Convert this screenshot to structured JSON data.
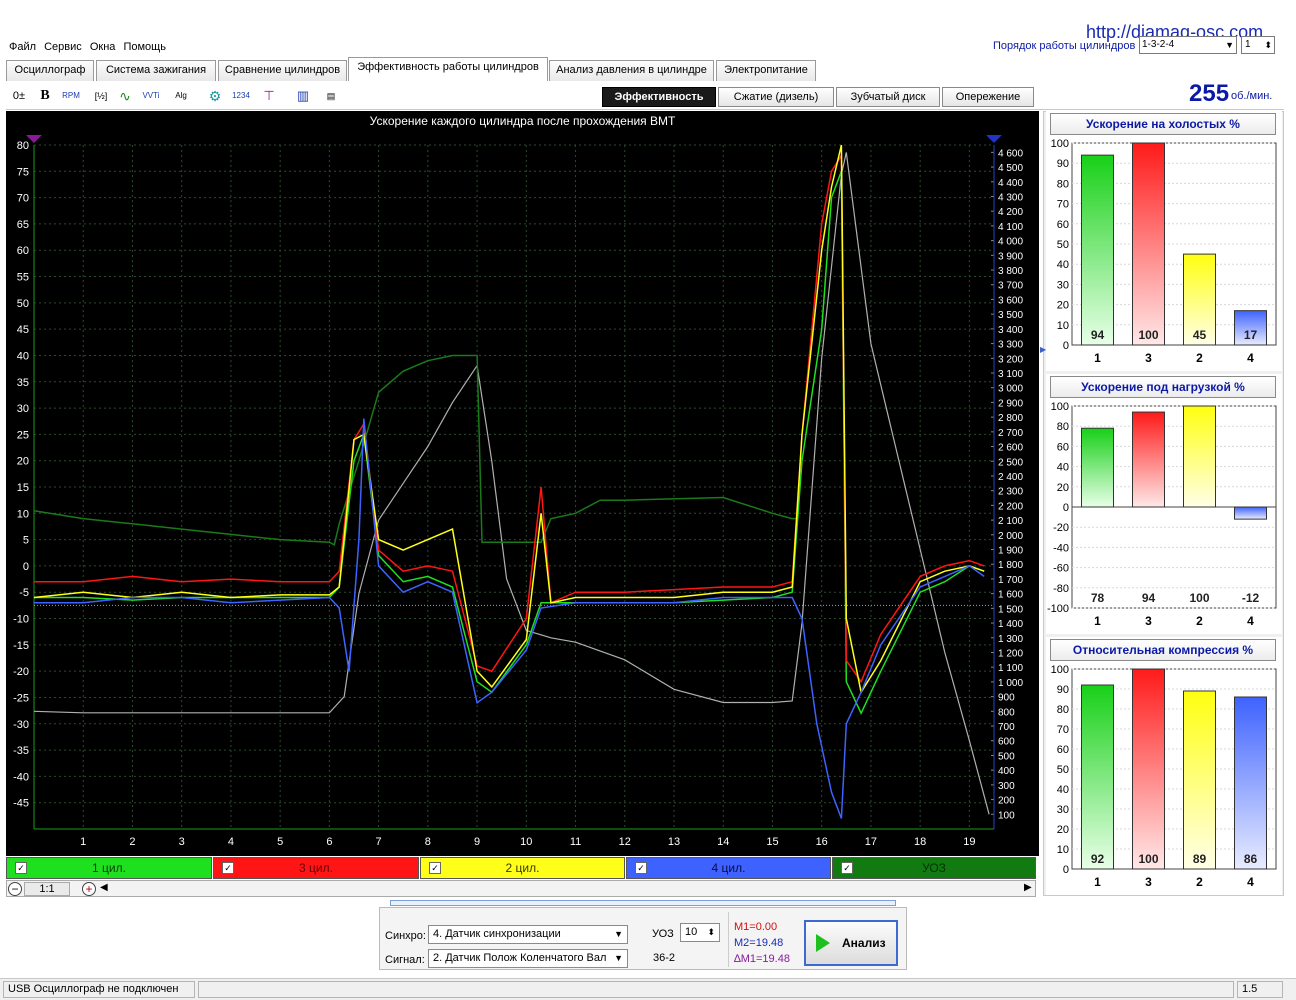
{
  "url": "http://diamag-osc.com",
  "menu": [
    "Файл",
    "Сервис",
    "Окна",
    "Помощь"
  ],
  "firing_order": {
    "label": "Порядок работы цилиндров",
    "value": "1-3-2-4",
    "stepper": "1"
  },
  "tabs": [
    "Осциллограф",
    "Система зажигания",
    "Сравнение цилиндров",
    "Эффективность работы цилиндров",
    "Анализ давления в цилиндре",
    "Электропитание"
  ],
  "active_tab": 3,
  "modes": [
    "Эффективность",
    "Сжатие (дизель)",
    "Зубчатый диск",
    "Опережение"
  ],
  "rpm": {
    "value": "255",
    "unit": "об./мин."
  },
  "colors": {
    "cyl1": "#1fe01f",
    "cyl3": "#ff1515",
    "cyl2": "#ffff1a",
    "cyl4": "#3e62ff",
    "uoz": "#1a7a1a",
    "rpm_trace": "#b0b0b0"
  },
  "chart": {
    "title": "Ускорение каждого цилиндра после прохождения ВМТ",
    "left_ticks": [
      "80",
      "75",
      "70",
      "65",
      "60",
      "55",
      "50",
      "45",
      "40",
      "35",
      "30",
      "25",
      "20",
      "15",
      "10",
      "5",
      "0",
      "-5",
      "-10",
      "-15",
      "-20",
      "-25",
      "-30",
      "-35",
      "-40",
      "-45"
    ],
    "right_ticks": [
      "4 600",
      "4 500",
      "4 400",
      "4 300",
      "4 200",
      "4 100",
      "4 000",
      "3 900",
      "3 800",
      "3 700",
      "3 600",
      "3 500",
      "3 400",
      "3 300",
      "3 200",
      "3 100",
      "3 000",
      "2 900",
      "2 800",
      "2 700",
      "2 600",
      "2 500",
      "2 400",
      "2 300",
      "2 200",
      "2 100",
      "2 000",
      "1 900",
      "1 800",
      "1 700",
      "1 600",
      "1 500",
      "1 400",
      "1 300",
      "1 200",
      "1 100",
      "1 000",
      "900",
      "800",
      "700",
      "600",
      "500",
      "400",
      "300",
      "200",
      "100"
    ],
    "x_ticks": [
      "1",
      "2",
      "3",
      "4",
      "5",
      "6",
      "7",
      "8",
      "9",
      "10",
      "11",
      "12",
      "13",
      "14",
      "15",
      "16",
      "17",
      "18",
      "19"
    ]
  },
  "chart_data": {
    "type": "line",
    "title": "Ускорение каждого цилиндра после прохождения ВМТ",
    "x_range": [
      0.0,
      19.5
    ],
    "y_left_range": [
      -50,
      80
    ],
    "y_right_range": [
      0,
      4650
    ],
    "series": [
      {
        "name": "1 цил.",
        "axis": "left",
        "points": [
          [
            0,
            -6
          ],
          [
            1,
            -6
          ],
          [
            2,
            -6.5
          ],
          [
            3,
            -6
          ],
          [
            4,
            -6
          ],
          [
            5,
            -6
          ],
          [
            6,
            -6
          ],
          [
            6.2,
            -4
          ],
          [
            6.5,
            20
          ],
          [
            6.7,
            25
          ],
          [
            7,
            2
          ],
          [
            7.5,
            -3
          ],
          [
            8,
            -2
          ],
          [
            8.5,
            -4
          ],
          [
            9,
            -22
          ],
          [
            9.3,
            -24
          ],
          [
            10,
            -15
          ],
          [
            10.3,
            -7
          ],
          [
            11,
            -7
          ],
          [
            12,
            -7
          ],
          [
            13,
            -7
          ],
          [
            14,
            -6.5
          ],
          [
            15,
            -6
          ],
          [
            15.4,
            -5
          ],
          [
            15.6,
            20
          ],
          [
            16,
            45
          ],
          [
            16.2,
            70
          ],
          [
            16.4,
            75
          ],
          [
            16.5,
            -22
          ],
          [
            16.8,
            -28
          ],
          [
            17.2,
            -20
          ],
          [
            18,
            -5
          ],
          [
            18.5,
            -3
          ],
          [
            19,
            0
          ],
          [
            19.3,
            -1
          ]
        ]
      },
      {
        "name": "3 цил.",
        "axis": "left",
        "points": [
          [
            0,
            -3
          ],
          [
            1,
            -3
          ],
          [
            2,
            -2
          ],
          [
            3,
            -3
          ],
          [
            4,
            -2.5
          ],
          [
            5,
            -3
          ],
          [
            6,
            -3
          ],
          [
            6.2,
            -1
          ],
          [
            6.5,
            24
          ],
          [
            6.7,
            27
          ],
          [
            7,
            3
          ],
          [
            7.5,
            -1
          ],
          [
            8,
            0
          ],
          [
            8.5,
            -1
          ],
          [
            9,
            -19
          ],
          [
            9.3,
            -20
          ],
          [
            10,
            -10
          ],
          [
            10.3,
            15
          ],
          [
            10.5,
            -7
          ],
          [
            11,
            -5
          ],
          [
            12,
            -5
          ],
          [
            13,
            -4.5
          ],
          [
            14,
            -4
          ],
          [
            15,
            -4
          ],
          [
            15.4,
            -3
          ],
          [
            15.6,
            25
          ],
          [
            16,
            65
          ],
          [
            16.2,
            75
          ],
          [
            16.4,
            78
          ],
          [
            16.5,
            -18
          ],
          [
            16.8,
            -22
          ],
          [
            17.2,
            -13
          ],
          [
            18,
            -2
          ],
          [
            18.5,
            0
          ],
          [
            19,
            1
          ],
          [
            19.3,
            0
          ]
        ]
      },
      {
        "name": "2 цил.",
        "axis": "left",
        "points": [
          [
            0,
            -6
          ],
          [
            1,
            -5
          ],
          [
            2,
            -6
          ],
          [
            3,
            -5
          ],
          [
            4,
            -6
          ],
          [
            5,
            -5.5
          ],
          [
            6,
            -5.5
          ],
          [
            6.2,
            -4
          ],
          [
            6.5,
            24
          ],
          [
            6.7,
            25
          ],
          [
            7,
            5
          ],
          [
            7.5,
            3
          ],
          [
            8,
            5
          ],
          [
            8.5,
            7
          ],
          [
            9,
            -20
          ],
          [
            9.3,
            -23
          ],
          [
            10,
            -14
          ],
          [
            10.3,
            10
          ],
          [
            10.5,
            -7
          ],
          [
            11,
            -6
          ],
          [
            12,
            -6
          ],
          [
            13,
            -6
          ],
          [
            14,
            -5
          ],
          [
            15,
            -5
          ],
          [
            15.4,
            -4
          ],
          [
            15.6,
            25
          ],
          [
            16,
            60
          ],
          [
            16.2,
            72
          ],
          [
            16.4,
            80
          ],
          [
            16.5,
            -10
          ],
          [
            16.8,
            -24
          ],
          [
            17.2,
            -18
          ],
          [
            18,
            -3
          ],
          [
            18.5,
            -1
          ],
          [
            19,
            0
          ],
          [
            19.3,
            -1
          ]
        ]
      },
      {
        "name": "4 цил.",
        "axis": "left",
        "points": [
          [
            0,
            -7
          ],
          [
            1,
            -7
          ],
          [
            2,
            -6
          ],
          [
            3,
            -6
          ],
          [
            4,
            -7
          ],
          [
            5,
            -6.5
          ],
          [
            6,
            -6
          ],
          [
            6.2,
            -8
          ],
          [
            6.4,
            -20
          ],
          [
            6.6,
            5
          ],
          [
            6.7,
            28
          ],
          [
            7,
            0
          ],
          [
            7.5,
            -5
          ],
          [
            8,
            -3
          ],
          [
            8.5,
            -5
          ],
          [
            9,
            -26
          ],
          [
            9.3,
            -24
          ],
          [
            10,
            -16
          ],
          [
            10.3,
            -8
          ],
          [
            11,
            -7
          ],
          [
            12,
            -7
          ],
          [
            13,
            -7
          ],
          [
            14,
            -6
          ],
          [
            15,
            -6
          ],
          [
            15.4,
            -6
          ],
          [
            15.6,
            -10
          ],
          [
            15.9,
            -30
          ],
          [
            16.2,
            -43
          ],
          [
            16.4,
            -48
          ],
          [
            16.5,
            -30
          ],
          [
            16.8,
            -24
          ],
          [
            17.2,
            -15
          ],
          [
            18,
            -4
          ],
          [
            18.5,
            -2
          ],
          [
            19,
            0
          ],
          [
            19.3,
            -2
          ]
        ]
      },
      {
        "name": "УОЗ",
        "axis": "left",
        "points": [
          [
            0,
            10.5
          ],
          [
            1,
            9
          ],
          [
            2,
            8
          ],
          [
            3,
            7
          ],
          [
            4,
            6
          ],
          [
            5,
            5
          ],
          [
            6,
            4.5
          ],
          [
            6.1,
            4
          ],
          [
            6.2,
            8
          ],
          [
            6.6,
            20
          ],
          [
            7,
            33
          ],
          [
            7.5,
            37
          ],
          [
            8,
            39
          ],
          [
            8.5,
            40
          ],
          [
            9,
            40
          ],
          [
            9.1,
            4.5
          ],
          [
            10,
            4.5
          ],
          [
            10.3,
            4.5
          ],
          [
            10.5,
            9
          ],
          [
            11,
            10
          ],
          [
            11.5,
            12.5
          ],
          [
            12,
            12.5
          ],
          [
            14,
            13
          ],
          [
            15,
            10
          ],
          [
            15.4,
            9
          ],
          [
            15.5,
            9
          ]
        ]
      },
      {
        "name": "RPM",
        "axis": "right",
        "points": [
          [
            0,
            800
          ],
          [
            1,
            790
          ],
          [
            2,
            790
          ],
          [
            3,
            790
          ],
          [
            4,
            790
          ],
          [
            5,
            790
          ],
          [
            6,
            790
          ],
          [
            6.3,
            900
          ],
          [
            6.6,
            1600
          ],
          [
            7,
            2100
          ],
          [
            7.5,
            2350
          ],
          [
            8,
            2600
          ],
          [
            8.5,
            2900
          ],
          [
            9,
            3150
          ],
          [
            9.3,
            2500
          ],
          [
            9.6,
            1700
          ],
          [
            10,
            1350
          ],
          [
            10.5,
            1300
          ],
          [
            11,
            1270
          ],
          [
            12,
            1150
          ],
          [
            13,
            950
          ],
          [
            14,
            860
          ],
          [
            15,
            860
          ],
          [
            15.4,
            870
          ],
          [
            15.6,
            1400
          ],
          [
            16,
            3200
          ],
          [
            16.4,
            4450
          ],
          [
            16.5,
            4600
          ],
          [
            17,
            3300
          ],
          [
            17.5,
            2600
          ],
          [
            18,
            1900
          ],
          [
            18.5,
            1200
          ],
          [
            19,
            600
          ],
          [
            19.4,
            100
          ]
        ]
      }
    ],
    "cursor_y_left": -7.5,
    "idle_acceleration": {
      "categories": [
        "1",
        "3",
        "2",
        "4"
      ],
      "values": [
        94,
        100,
        45,
        17
      ],
      "ylim": [
        0,
        100
      ]
    },
    "load_acceleration": {
      "categories": [
        "1",
        "3",
        "2",
        "4"
      ],
      "values": [
        78,
        94,
        100,
        -12
      ],
      "ylim": [
        -100,
        100
      ]
    },
    "relative_compression": {
      "categories": [
        "1",
        "3",
        "2",
        "4"
      ],
      "values": [
        92,
        100,
        89,
        86
      ],
      "ylim": [
        0,
        100
      ]
    }
  },
  "legend": [
    {
      "label": "1 цил.",
      "color": "#1fe01f",
      "text": "#0a3a0a"
    },
    {
      "label": "3 цил.",
      "color": "#ff1515",
      "text": "#6a0000"
    },
    {
      "label": "2 цил.",
      "color": "#ffff1a",
      "text": "#3a3a00"
    },
    {
      "label": "4 цил.",
      "color": "#3e62ff",
      "text": "#0a0a4a"
    },
    {
      "label": "УОЗ",
      "color": "#117a11",
      "text": "#003300"
    }
  ],
  "zoom": "1:1",
  "panels": [
    {
      "title": "Ускорение на холостых %",
      "key": "idle_acceleration",
      "ticks": [
        "100",
        "90",
        "80",
        "70",
        "60",
        "50",
        "40",
        "30",
        "20",
        "10",
        "0"
      ]
    },
    {
      "title": "Ускорение под нагрузкой %",
      "key": "load_acceleration",
      "ticks": [
        "100",
        "80",
        "60",
        "40",
        "20",
        "0",
        "-20",
        "-40",
        "-60",
        "-80",
        "-100"
      ]
    },
    {
      "title": "Относительная компрессия %",
      "key": "relative_compression",
      "ticks": [
        "100",
        "90",
        "80",
        "70",
        "60",
        "50",
        "40",
        "30",
        "20",
        "10",
        "0"
      ]
    }
  ],
  "bottom": {
    "sync_label": "Синхро:",
    "sync_value": "4.  Датчик синхронизации",
    "signal_label": "Сигнал:",
    "signal_value": "2.  Датчик Полож Коленчатого Вал",
    "uoz_label": "УОЗ",
    "uoz_value": "10",
    "teeth": "36-2",
    "m1": "M1=0.00",
    "m2": "M2=19.48",
    "dm1": "∆M1=19.48",
    "analyze": "Анализ"
  },
  "status": {
    "left": "USB Осциллограф не подключен",
    "right": "1.5"
  }
}
